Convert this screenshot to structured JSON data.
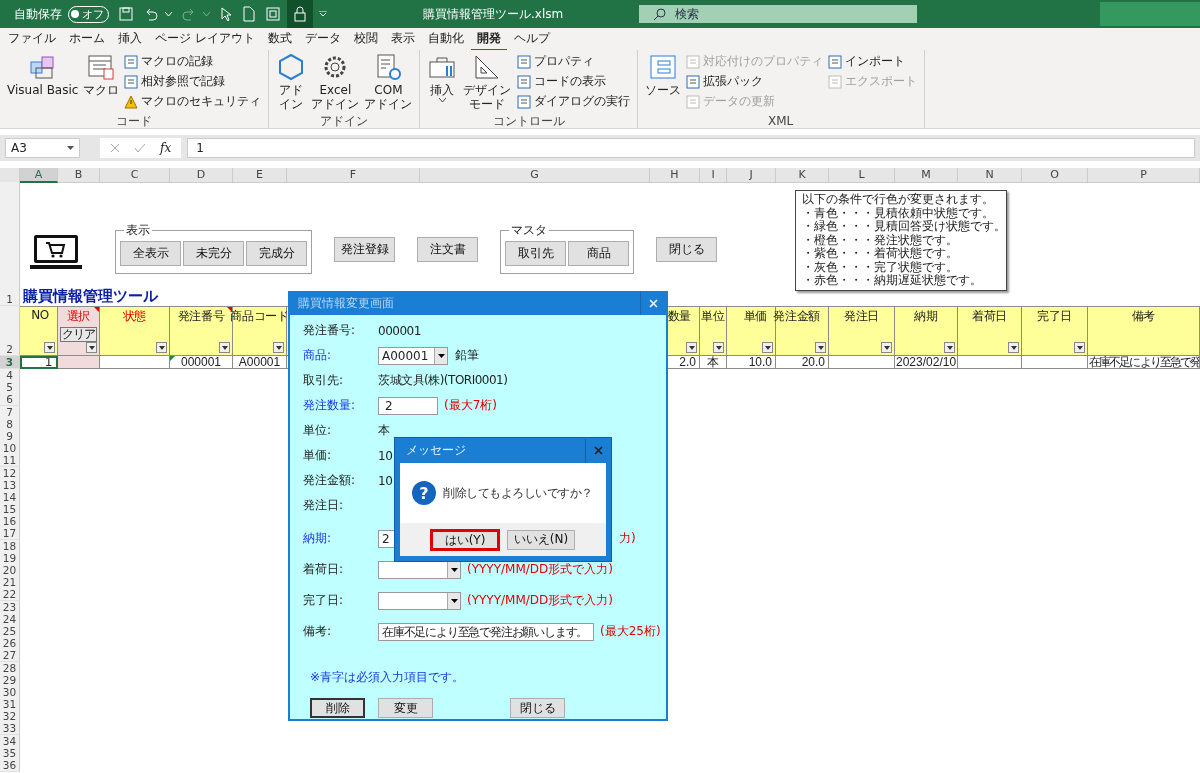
{
  "title_bar": {
    "autosave_label": "自動保存",
    "autosave": {
      "label": "オフ",
      "on": false
    },
    "redo": {
      "disabled": true
    },
    "file_name": "購買情報管理ツール.xlsm",
    "search": {
      "placeholder": "検索"
    }
  },
  "tabs": [
    {
      "label": "ファイル",
      "selected": false
    },
    {
      "label": "ホーム",
      "selected": false
    },
    {
      "label": "挿入",
      "selected": false
    },
    {
      "label": "ページ レイアウト",
      "selected": false
    },
    {
      "label": "数式",
      "selected": false
    },
    {
      "label": "データ",
      "selected": false
    },
    {
      "label": "校閲",
      "selected": false
    },
    {
      "label": "表示",
      "selected": false
    },
    {
      "label": "自動化",
      "selected": false
    },
    {
      "label": "開発",
      "selected": true
    },
    {
      "label": "ヘルプ",
      "selected": false
    }
  ],
  "ribbon": {
    "groups": [
      {
        "label": "コード",
        "large": [
          {
            "label": "Visual Basic",
            "menu": false
          },
          {
            "label": "マクロ",
            "menu": false
          }
        ],
        "small": [
          [
            {
              "label": "マクロの記録",
              "disabled": false
            },
            {
              "label": "相対参照で記録",
              "disabled": false
            },
            {
              "label": "マクロのセキュリティ",
              "disabled": false
            }
          ]
        ]
      },
      {
        "label": "アドイン",
        "large": [
          {
            "label": "アドイン",
            "menu": false
          },
          {
            "label": "Excel\nアドイン",
            "menu": false
          },
          {
            "label": "COM\nアドイン",
            "menu": false
          }
        ]
      },
      {
        "label": "コントロール",
        "large": [
          {
            "label": "挿入",
            "menu": true
          },
          {
            "label": "デザインモード",
            "menu": false
          }
        ],
        "small": [
          [
            {
              "label": "プロパティ",
              "disabled": false
            },
            {
              "label": "コードの表示",
              "disabled": false
            },
            {
              "label": "ダイアログの実行",
              "disabled": false
            }
          ]
        ]
      },
      {
        "label": "XML",
        "large": [
          {
            "label": "ソース",
            "menu": false
          }
        ],
        "small": [
          [
            {
              "label": "対応付けのプロパティ",
              "disabled": true
            },
            {
              "label": "拡張パック",
              "disabled": false
            },
            {
              "label": "データの更新",
              "disabled": true
            }
          ],
          [
            {
              "label": "インポート",
              "disabled": false
            },
            {
              "label": "エクスポート",
              "disabled": true
            }
          ]
        ]
      }
    ]
  },
  "formula_bar": {
    "name_box": "A3",
    "function_label": "fx",
    "formula": "1"
  },
  "sheet": {
    "title": "購買情報管理ツール",
    "columns": [
      {
        "letter": "A",
        "header": "NO",
        "kind": "data",
        "filter": true,
        "comment": false,
        "selected": true,
        "cell": {
          "text": "1",
          "selected": true
        }
      },
      {
        "letter": "B",
        "header": "選択",
        "kind": "select",
        "button": "クリア",
        "filter": true,
        "comment": true,
        "selected": false
      },
      {
        "letter": "C",
        "header": "状態",
        "kind": "status",
        "filter": true,
        "comment": false,
        "selected": false
      },
      {
        "letter": "D",
        "header": "発注番号",
        "kind": "data",
        "filter": true,
        "comment": true,
        "selected": false,
        "cell": {
          "text": "000001",
          "selected": false,
          "flag": true
        }
      },
      {
        "letter": "E",
        "header": "商品コード",
        "kind": "data",
        "filter": true,
        "comment": false,
        "selected": false,
        "cell": {
          "text": "A00001",
          "selected": false
        }
      },
      {
        "letter": "F",
        "kind": "data",
        "selected": false
      },
      {
        "letter": "G",
        "kind": "data",
        "selected": false
      },
      {
        "letter": "H",
        "header": "数量",
        "kind": "data",
        "filter": true,
        "comment": false,
        "selected": false,
        "cell": {
          "text": "2.0",
          "selected": false
        }
      },
      {
        "letter": "I",
        "header": "単位",
        "kind": "data",
        "filter": true,
        "comment": false,
        "selected": false,
        "cell": {
          "text": "本",
          "selected": false
        }
      },
      {
        "letter": "J",
        "header": "単価",
        "kind": "data",
        "filter": true,
        "comment": false,
        "selected": false,
        "cell": {
          "text": "10.0",
          "selected": false
        }
      },
      {
        "letter": "K",
        "header": "発注金額",
        "kind": "data",
        "filter": true,
        "comment": false,
        "selected": false,
        "cell": {
          "text": "20.0",
          "selected": false
        }
      },
      {
        "letter": "L",
        "header": "発注日",
        "kind": "data",
        "filter": true,
        "comment": false,
        "selected": false
      },
      {
        "letter": "M",
        "header": "納期",
        "kind": "data",
        "filter": true,
        "comment": false,
        "selected": false,
        "cell": {
          "text": "2023/02/10",
          "selected": false
        }
      },
      {
        "letter": "N",
        "header": "着荷日",
        "kind": "data",
        "filter": true,
        "comment": false,
        "selected": false
      },
      {
        "letter": "O",
        "header": "完了日",
        "kind": "data",
        "filter": true,
        "comment": false,
        "selected": false
      },
      {
        "letter": "P",
        "header": "備考",
        "kind": "data",
        "filter": false,
        "comment": false,
        "selected": false,
        "cell": {
          "text": "在庫不足により至急で発",
          "selected": false
        }
      }
    ],
    "row_headers": [
      {
        "label": "1",
        "selected": false
      },
      {
        "label": "2",
        "selected": false
      },
      {
        "label": "3",
        "selected": true
      },
      {
        "label": "4",
        "selected": false
      },
      {
        "label": "5",
        "selected": false
      },
      {
        "label": "6",
        "selected": false
      },
      {
        "label": "7",
        "selected": false
      },
      {
        "label": "8",
        "selected": false
      },
      {
        "label": "9",
        "selected": false
      },
      {
        "label": "10",
        "selected": false
      },
      {
        "label": "11",
        "selected": false
      },
      {
        "label": "12",
        "selected": false
      },
      {
        "label": "13",
        "selected": false
      },
      {
        "label": "14",
        "selected": false
      },
      {
        "label": "15",
        "selected": false
      },
      {
        "label": "16",
        "selected": false
      },
      {
        "label": "17",
        "selected": false
      },
      {
        "label": "18",
        "selected": false
      },
      {
        "label": "19",
        "selected": false
      },
      {
        "label": "20",
        "selected": false
      },
      {
        "label": "21",
        "selected": false
      },
      {
        "label": "22",
        "selected": false
      },
      {
        "label": "23",
        "selected": false
      },
      {
        "label": "24",
        "selected": false
      },
      {
        "label": "25",
        "selected": false
      },
      {
        "label": "26",
        "selected": false
      },
      {
        "label": "27",
        "selected": false
      },
      {
        "label": "28",
        "selected": false
      },
      {
        "label": "29",
        "selected": false
      },
      {
        "label": "30",
        "selected": false
      },
      {
        "label": "31",
        "selected": false
      },
      {
        "label": "32",
        "selected": false
      },
      {
        "label": "33",
        "selected": false
      },
      {
        "label": "34",
        "selected": false
      },
      {
        "label": "35",
        "selected": false
      },
      {
        "label": "36",
        "selected": false
      }
    ],
    "toolbar": [
      {
        "kind": "group",
        "label": "表示",
        "buttons": [
          "全表示",
          "未完分",
          "完成分"
        ]
      },
      {
        "kind": "button",
        "label": "発注登録"
      },
      {
        "kind": "button",
        "label": "注文書"
      },
      {
        "kind": "group",
        "label": "マスタ",
        "buttons": [
          "取引先",
          "商品"
        ]
      },
      {
        "kind": "button",
        "label": "閉じる"
      }
    ],
    "legend": [
      "以下の条件で行色が変更されます。",
      "・青色・・・見積依頼中状態です。",
      "・緑色・・・見積回答受け状態です。",
      "・橙色・・・発注状態です。",
      "・紫色・・・着荷状態です。",
      "・灰色・・・完了状態です。",
      "・赤色・・・納期遅延状態です。"
    ]
  },
  "form": {
    "title": "購買情報変更画面",
    "rows": [
      {
        "kind": "text",
        "label": "発注番号:",
        "required": false,
        "value": "000001"
      },
      {
        "kind": "combo",
        "label": "商品:",
        "required": true,
        "value": "A00001",
        "after": "鉛筆"
      },
      {
        "kind": "text",
        "label": "取引先:",
        "required": false,
        "value": "茨城文具(株)(TORI0001)"
      },
      {
        "kind": "input",
        "label": "発注数量:",
        "required": true,
        "value": "2",
        "hint": "(最大7桁)"
      },
      {
        "kind": "text",
        "label": "単位:",
        "required": false,
        "value": "本"
      },
      {
        "kind": "text",
        "label": "単価:",
        "required": false,
        "value": "10"
      },
      {
        "kind": "text",
        "label": "発注金額:",
        "required": false,
        "value": "10"
      },
      {
        "kind": "text",
        "label": "発注日:",
        "required": false
      },
      {
        "kind": "combo",
        "label": "納期:",
        "required": true,
        "value": "2",
        "hint": "力)",
        "covered": true
      },
      {
        "kind": "combo",
        "label": "着荷日:",
        "required": false,
        "hint": "(YYYY/MM/DD形式で入力)"
      },
      {
        "kind": "combo",
        "label": "完了日:",
        "required": false,
        "hint": "(YYYY/MM/DD形式で入力)"
      },
      {
        "kind": "input",
        "label": "備考:",
        "required": false,
        "value": "在庫不足により至急で発注お願いします。",
        "hint": "(最大25桁)"
      }
    ],
    "note": "※青字は必須入力項目です。",
    "buttons": [
      {
        "label": "削除",
        "focused": true
      },
      {
        "label": "変更",
        "focused": false
      },
      {
        "label": "閉じる",
        "focused": false
      }
    ]
  },
  "message": {
    "title": "メッセージ",
    "icon": "?",
    "text": "削除してもよろしいですか？",
    "buttons": [
      {
        "label": "はい(Y)",
        "highlighted": true
      },
      {
        "label": "いいえ(N)",
        "highlighted": false
      }
    ]
  }
}
